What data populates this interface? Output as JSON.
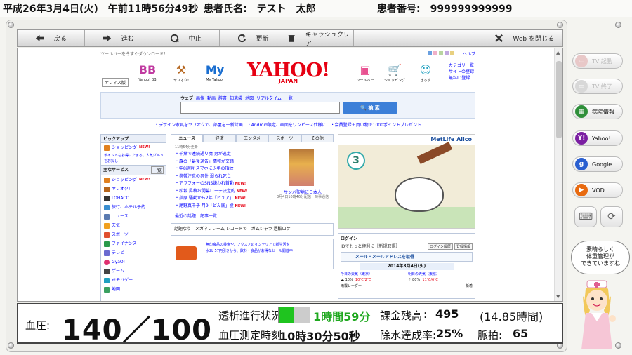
{
  "header": {
    "datetime": "平成26年3月4日(火)　午前11時56分49秒",
    "patient_name_label": "患者氏名:　テスト　太郎",
    "patient_number_label": "患者番号:　999999999999"
  },
  "nav": {
    "back": "戻る",
    "forward": "進む",
    "stop": "中止",
    "refresh": "更新",
    "clear_cache": "キャッシュクリア",
    "close_web": "Web を閉じる"
  },
  "yahoo": {
    "promo": "ツールバーを今すぐダウンロード！",
    "help": "ヘルプ",
    "office": "オフィス版",
    "services": [
      "Yahoo! BB",
      "ヤフオク!",
      "My Yahoo!",
      "ツールバー",
      "ショッピング",
      "きっず"
    ],
    "logo": "YAHOO!",
    "logo_sub": "JAPAN",
    "right_links": [
      "カテゴリ一覧",
      "サイトの登録",
      "無料ID登録"
    ],
    "search_tabs": [
      "ウェブ",
      "画像",
      "動画",
      "辞書",
      "知恵袋",
      "地図",
      "リアルタイム",
      "一覧"
    ],
    "search_button": "検 索",
    "news_line": "・デザイン家具をヤフオクで、部屋を一新計画　・Android限定、画面をワンピース仕様に　・会員登録＋買い物で1000ポイントプレゼント",
    "pickup_title": "ピックアップ",
    "pickup_items": [
      "ショッピング",
      "ポイントもお得にたまる。人気グルメをお探し"
    ],
    "main_services_title": "主なサービス",
    "main_services_more": "一覧",
    "left_items": [
      "ショッピング",
      "ヤフオク!",
      "LOHACO",
      "旅行、ホテル予約",
      "ニュース",
      "天気",
      "スポーツ",
      "ファイナンス",
      "テレビ",
      "GyaO!",
      "ゲーム",
      "Y!モバゲー",
      "地図"
    ],
    "new_label": "NEW!",
    "news_tabs": [
      "ニュース",
      "経済",
      "エンタメ",
      "スポーツ",
      "その他"
    ],
    "news_time": "11時54分更新",
    "news_items": [
      "千葉で連続通り魔 男が逃走",
      "森の「最後通告」情報が交錯",
      "中8話旨 スマホに少年の指紋",
      "携帯注意の男性 弱られ死亡",
      "アラフォーのSNS嫌われ首動",
      "松坂 昇格お開幕ローテ決定的",
      "指原 騒動から2年「ピュア」",
      "尾野真千子 月9「どん底」役"
    ],
    "news_photo_caption": "サンバ聖地に日本人",
    "news_photo_sub": "3月4日10時46分配信　時事通信",
    "news_footer": "最近の話題　記事一覧",
    "banner2_text": "話題なう　メガネフレーム レコードで　ガムシャラ 過酷ロケ",
    "banner3_lines": [
      "・無印良品の検索や、アクスノのインテリアで新生活を",
      "・水2L 57円引きから、飲料・食品がお得なセール開催中"
    ],
    "ad_brand": "MetLife Alico",
    "ad_number": "3",
    "login_title": "ログイン",
    "login_sub": "IDでもっと便利に［新規取得］",
    "login_btn1": "ログイン履歴",
    "login_btn2": "登録情報",
    "mail_text": "メール・メールアドレスを取得",
    "weather_date": "2014年3月4日(火)",
    "weather_today": "今日の天気（東京）",
    "weather_tomorrow": "明日の天気（東京）",
    "today_pct": "10%",
    "today_temp": "10℃/2℃",
    "tomorrow_pct": "80%",
    "tomorrow_temp": "11℃/6℃",
    "rain_radar": "雨雲レーダー",
    "new_arrival": "新着"
  },
  "vitals": {
    "bp_label": "血圧:",
    "bp_value": "140／100",
    "dialysis_label": "透析進行状況:",
    "progress_fraction": 0.5,
    "remaining": "1時間59分",
    "charge_label": "課金残高",
    "charge_colon": ":",
    "charge_value": "495",
    "charge_hours": "(14.85時間)",
    "bp_time_label": "血圧測定時刻:",
    "bp_time": "10時30分50秒",
    "water_label": "除水達成率:",
    "water_value": "25%",
    "pulse_label": "脈拍:",
    "pulse_value": "65"
  },
  "side": {
    "tv_on": "TV 起動",
    "tv_off": "TV 終了",
    "hospital": "病院情報",
    "yahoo": "Yahoo!",
    "google": "Google",
    "vod": "VOD",
    "bubble": "素晴らしく\n体重管理が\nできていますね"
  }
}
